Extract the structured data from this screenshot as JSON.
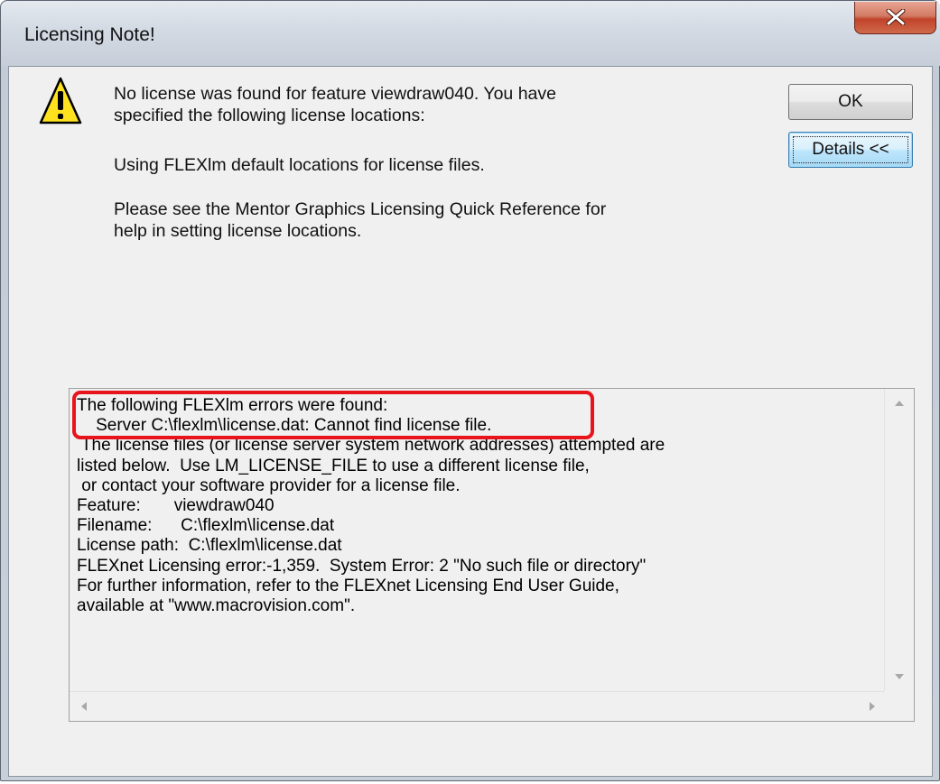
{
  "window": {
    "title": "Licensing Note!"
  },
  "message": {
    "line1": "No license was found for feature viewdraw040.  You have",
    "line2": "specified the following license locations:",
    "line3": "Using FLEXlm default locations for license files.",
    "line4": "Please see the Mentor Graphics Licensing Quick Reference for",
    "line5": "help in setting license locations."
  },
  "buttons": {
    "ok_label": "OK",
    "details_label": "Details <<"
  },
  "details": {
    "text": "The following FLEXlm errors were found:\n    Server C:\\flexlm\\license.dat: Cannot find license file.\n The license files (or license server system network addresses) attempted are\nlisted below.  Use LM_LICENSE_FILE to use a different license file,\n or contact your software provider for a license file.\nFeature:       viewdraw040\nFilename:      C:\\flexlm\\license.dat\nLicense path:  C:\\flexlm\\license.dat\nFLEXnet Licensing error:-1,359.  System Error: 2 \"No such file or directory\"\nFor further information, refer to the FLEXnet Licensing End User Guide,\navailable at \"www.macrovision.com\"."
  },
  "colors": {
    "highlight": "#e8141b",
    "warning_fill": "#ffe21f",
    "close_button": "#c1432a"
  },
  "icons": {
    "close": "close-icon",
    "warning": "warning-icon"
  }
}
